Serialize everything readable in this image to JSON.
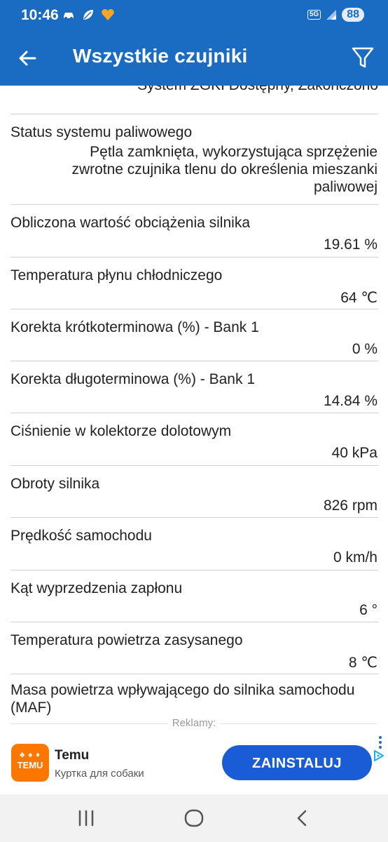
{
  "status_bar": {
    "time": "10:46",
    "network": "5G",
    "battery": "88",
    "icons": [
      "car-icon",
      "leaf-icon",
      "heart-icon",
      "signal-icon"
    ]
  },
  "app_bar": {
    "title": "Wszystkie czujniki",
    "icons": [
      "back-arrow-icon",
      "filter-icon"
    ]
  },
  "partial_top_text": "System ZGKI Dostępny, Zakończono",
  "sensors": [
    {
      "label": "Status systemu paliwowego",
      "value": "Pętla zamknięta, wykorzystująca sprzężenie zwrotne czujnika tlenu do określenia mieszanki paliwowej"
    },
    {
      "label": "Obliczona wartość obciążenia silnika",
      "value": "19.61 %"
    },
    {
      "label": "Temperatura płynu chłodniczego",
      "value": "64 ℃"
    },
    {
      "label": "Korekta krótkoterminowa (%) - Bank 1",
      "value": "0 %"
    },
    {
      "label": "Korekta długoterminowa (%) - Bank 1",
      "value": "14.84 %"
    },
    {
      "label": "Ciśnienie w kolektorze dolotowym",
      "value": "40 kPa"
    },
    {
      "label": "Obroty silnika",
      "value": "826 rpm"
    },
    {
      "label": "Prędkość samochodu",
      "value": "0 km/h"
    },
    {
      "label": "Kąt wyprzedzenia zapłonu",
      "value": "6 °"
    },
    {
      "label": "Temperatura powietrza zasysanego",
      "value": "8 ℃"
    },
    {
      "label": "Masa powietrza wpływającego do silnika samochodu (MAF)",
      "value": ""
    }
  ],
  "ad": {
    "label": "Reklamy:",
    "logo_text": "TEMU",
    "app_name": "Temu",
    "subtitle": "Куртка для собаки",
    "button": "ZAINSTALUJ",
    "colors": {
      "brand": "#fb7701",
      "button": "#1a5cd6"
    }
  },
  "nav_bar": {
    "icons": [
      "recent-apps-icon",
      "home-icon",
      "back-icon"
    ]
  },
  "colors": {
    "primary": "#1a6cc2"
  }
}
